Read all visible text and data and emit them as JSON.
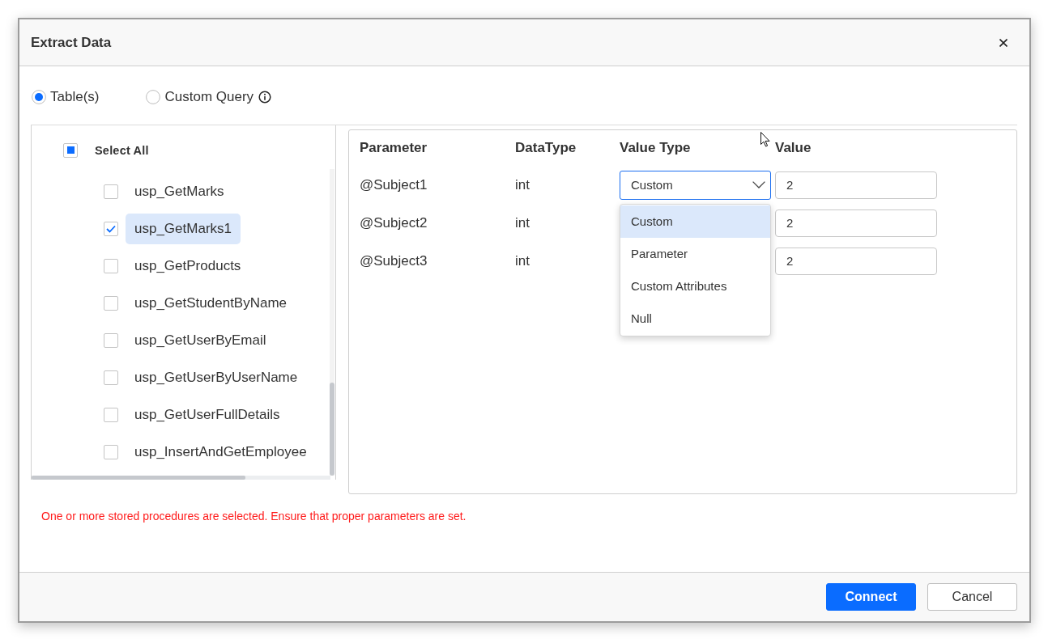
{
  "dialog": {
    "title": "Extract Data"
  },
  "source_options": [
    {
      "label": "Table(s)",
      "selected": true,
      "info": false
    },
    {
      "label": "Custom Query",
      "selected": false,
      "info": true
    }
  ],
  "procedures": {
    "select_all": {
      "label": "Select All",
      "indeterminate": true
    },
    "items": [
      {
        "name": "usp_GetMarks",
        "checked": false,
        "selected": false
      },
      {
        "name": "usp_GetMarks1",
        "checked": true,
        "selected": true
      },
      {
        "name": "usp_GetProducts",
        "checked": false,
        "selected": false
      },
      {
        "name": "usp_GetStudentByName",
        "checked": false,
        "selected": false
      },
      {
        "name": "usp_GetUserByEmail",
        "checked": false,
        "selected": false
      },
      {
        "name": "usp_GetUserByUserName",
        "checked": false,
        "selected": false
      },
      {
        "name": "usp_GetUserFullDetails",
        "checked": false,
        "selected": false
      },
      {
        "name": "usp_InsertAndGetEmployee",
        "checked": false,
        "selected": false
      }
    ]
  },
  "parameters": {
    "columns": [
      "Parameter",
      "DataType",
      "Value Type",
      "Value"
    ],
    "rows": [
      {
        "parameter": "@Subject1",
        "data_type": "int",
        "value_type": {
          "value": "Custom",
          "open": true,
          "options": [
            {
              "label": "Custom",
              "selected": true
            },
            {
              "label": "Parameter",
              "selected": false
            },
            {
              "label": "Custom Attributes",
              "selected": false
            },
            {
              "label": "Null",
              "selected": false
            }
          ]
        },
        "value": "2"
      },
      {
        "parameter": "@Subject2",
        "data_type": "int",
        "value": "2"
      },
      {
        "parameter": "@Subject3",
        "data_type": "int",
        "value": "2"
      }
    ]
  },
  "message": "One or more stored procedures are selected. Ensure that proper parameters are set.",
  "buttons": [
    {
      "label": "Connect",
      "kind": "primary"
    },
    {
      "label": "Cancel",
      "kind": "secondary"
    }
  ]
}
